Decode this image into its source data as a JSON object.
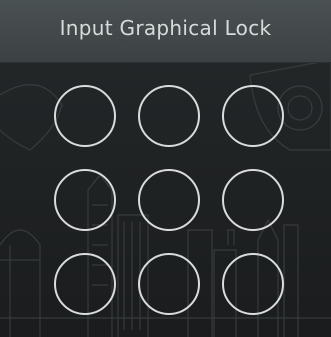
{
  "header": {
    "title": "Input Graphical Lock"
  },
  "lock_grid": {
    "rows": 3,
    "columns": 3,
    "nodes": [
      1,
      2,
      3,
      4,
      5,
      6,
      7,
      8,
      9
    ],
    "ring_color": "#d9dcdd"
  },
  "background": {
    "accent": "#3c4243",
    "base": "#1e2122"
  }
}
